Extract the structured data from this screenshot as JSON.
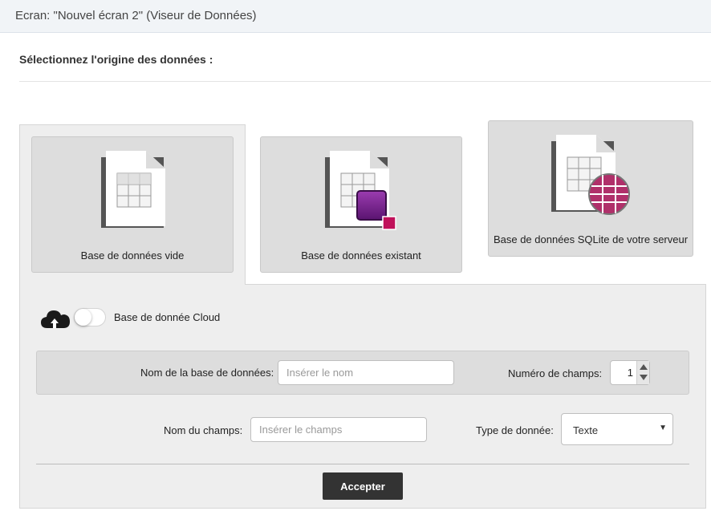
{
  "window": {
    "title": "Ecran: \"Nouvel écran 2\" (Viseur de Données)"
  },
  "heading": "Sélectionnez l'origine des données :",
  "sources": [
    {
      "label": "Base de données vide",
      "icon": "blank-database-icon",
      "active": true
    },
    {
      "label": "Base de données existant",
      "icon": "existing-database-icon",
      "active": false
    },
    {
      "label": "Base de données SQLite de votre serveur",
      "icon": "sqlite-server-database-icon",
      "active": false
    }
  ],
  "cloud": {
    "label": "Base de donnée Cloud",
    "enabled": false,
    "icon": "cloud-upload-icon"
  },
  "db_name": {
    "label": "Nom de la base de données:",
    "placeholder": "Insérer le nom",
    "value": ""
  },
  "field_count": {
    "label": "Numéro de champs:",
    "value": "1"
  },
  "field_name": {
    "label": "Nom du champs:",
    "placeholder": "Insérer le champs",
    "value": ""
  },
  "data_type": {
    "label": "Type de donnée:",
    "value": "Texte",
    "caret": "▼"
  },
  "accept_button": {
    "label": "Accepter"
  },
  "colors": {
    "accent_purple": "#7b2a8f",
    "accent_magenta": "#c0115a",
    "sqlite_globe": "#b0306a",
    "button": "#333333"
  }
}
